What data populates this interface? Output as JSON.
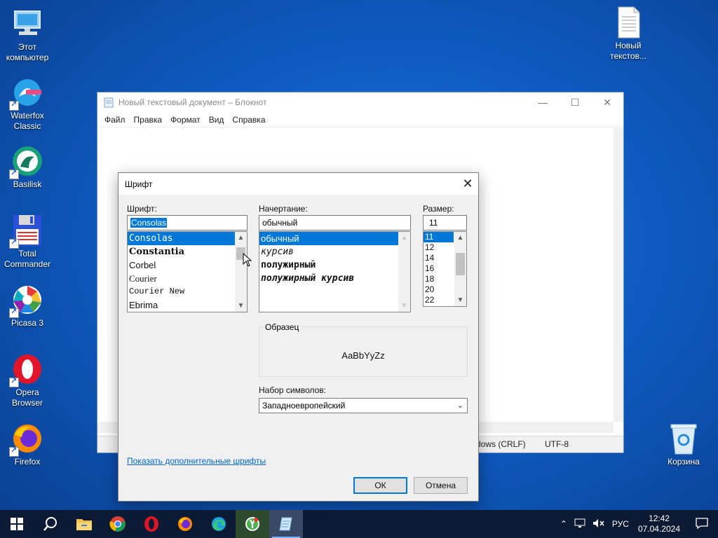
{
  "desktop": {
    "icons": [
      {
        "label": "Этот компьютер"
      },
      {
        "label": "Waterfox Classic"
      },
      {
        "label": "Basilisk"
      },
      {
        "label": "Total Commander"
      },
      {
        "label": "Picasa 3"
      },
      {
        "label": "Opera Browser"
      },
      {
        "label": "Firefox"
      },
      {
        "label": "Новый текстов..."
      },
      {
        "label": "Корзина"
      }
    ]
  },
  "notepad": {
    "title": "Новый текстовый документ – Блокнот",
    "menu": [
      "Файл",
      "Правка",
      "Формат",
      "Вид",
      "Справка"
    ],
    "status_eol": "dows (CRLF)",
    "status_enc": "UTF-8"
  },
  "font_dialog": {
    "title": "Шрифт",
    "font_label": "Шрифт:",
    "font_value": "Consolas",
    "fonts": [
      "Consolas",
      "Constantia",
      "Corbel",
      "Courier",
      "Courier New",
      "Ebrima"
    ],
    "style_label": "Начертание:",
    "style_value": "обычный",
    "styles": [
      "обычный",
      "курсив",
      "полужирный",
      "полужирный курсив"
    ],
    "size_label": "Размер:",
    "size_value": "11",
    "sizes": [
      "11",
      "12",
      "14",
      "16",
      "18",
      "20",
      "22"
    ],
    "sample_label": "Образец",
    "sample_text": "AaBbYyZz",
    "charset_label": "Набор символов:",
    "charset_value": "Западноевропейский",
    "more_fonts_link": "Показать дополнительные шрифты",
    "ok_label": "ОК",
    "cancel_label": "Отмена"
  },
  "taskbar": {
    "language": "РУС",
    "time": "12:42",
    "date": "07.04.2024"
  },
  "colors": {
    "accent": "#0078d7",
    "desktop": "#0f5bc2",
    "taskbar": "#0c1b33"
  }
}
